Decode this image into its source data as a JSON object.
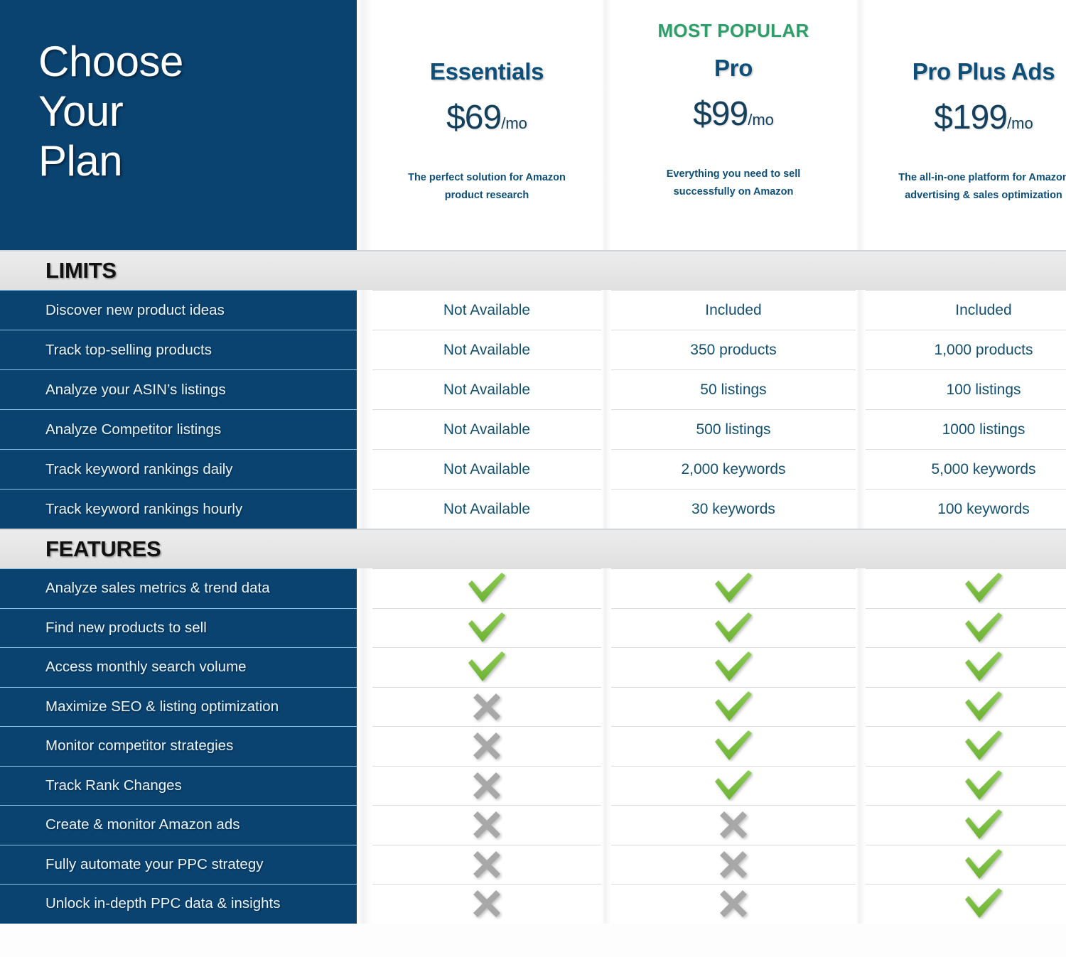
{
  "hero": {
    "title": "Choose\nYour\nPlan"
  },
  "colors": {
    "brand_dark_blue": "#0a4270",
    "brand_link_blue": "#0d4f78",
    "accent_green": "#2d9d6a",
    "check_green": "#76bf43",
    "cross_gray": "#a6a6a6",
    "band_gray": "#e6e6e6"
  },
  "plans": [
    {
      "badge": "",
      "name": "Essentials",
      "price": "$69",
      "period": "/mo",
      "description": "The perfect solution for Amazon product research"
    },
    {
      "badge": "MOST POPULAR",
      "name": "Pro",
      "price": "$99",
      "period": "/mo",
      "description": "Everything you need to sell successfully on Amazon"
    },
    {
      "badge": "",
      "name": "Pro Plus Ads",
      "price": "$199",
      "period": "/mo",
      "description": "The all-in-one platform for Amazon advertising & sales optimization"
    }
  ],
  "sections": [
    {
      "heading": "LIMITS",
      "rows": [
        {
          "label": "Discover new product ideas",
          "values": [
            "Not Available",
            "Included",
            "Included"
          ]
        },
        {
          "label": "Track top-selling products",
          "values": [
            "Not Available",
            "350 products",
            "1,000 products"
          ]
        },
        {
          "label": "Analyze your ASIN’s listings",
          "values": [
            "Not Available",
            "50 listings",
            "100 listings"
          ]
        },
        {
          "label": "Analyze Competitor listings",
          "values": [
            "Not Available",
            "500 listings",
            "1000 listings"
          ]
        },
        {
          "label": "Track keyword rankings daily",
          "values": [
            "Not Available",
            "2,000 keywords",
            "5,000 keywords"
          ]
        },
        {
          "label": "Track keyword rankings hourly",
          "values": [
            "Not Available",
            "30 keywords",
            "100 keywords"
          ]
        }
      ]
    },
    {
      "heading": "FEATURES",
      "rows": [
        {
          "label": "Analyze sales metrics & trend data",
          "values": [
            "check",
            "check",
            "check"
          ]
        },
        {
          "label": "Find new products to sell",
          "values": [
            "check",
            "check",
            "check"
          ]
        },
        {
          "label": "Access monthly search volume",
          "values": [
            "check",
            "check",
            "check"
          ]
        },
        {
          "label": "Maximize SEO & listing optimization",
          "values": [
            "cross",
            "check",
            "check"
          ]
        },
        {
          "label": "Monitor competitor strategies",
          "values": [
            "cross",
            "check",
            "check"
          ]
        },
        {
          "label": "Track Rank Changes",
          "values": [
            "cross",
            "check",
            "check"
          ]
        },
        {
          "label": "Create & monitor Amazon ads",
          "values": [
            "cross",
            "cross",
            "check"
          ]
        },
        {
          "label": "Fully automate your PPC strategy",
          "values": [
            "cross",
            "cross",
            "check"
          ]
        },
        {
          "label": "Unlock in-depth PPC data & insights",
          "values": [
            "cross",
            "cross",
            "check"
          ]
        }
      ]
    }
  ],
  "icons": {
    "check": "check-icon",
    "cross": "cross-icon"
  }
}
